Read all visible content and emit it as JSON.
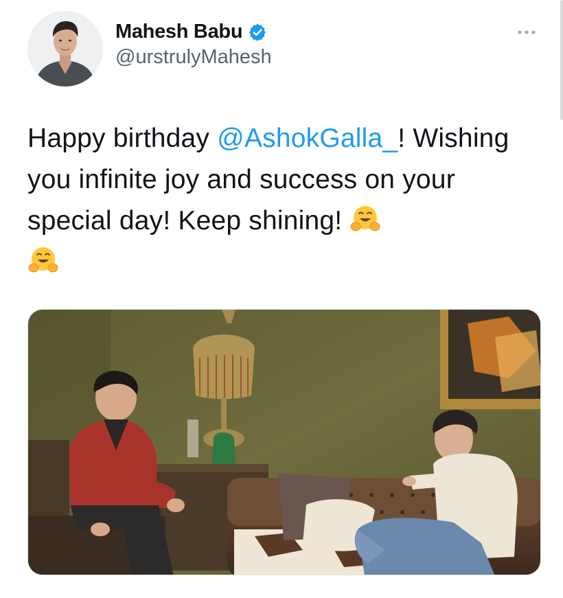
{
  "author": {
    "display_name": "Mahesh Babu",
    "handle": "@urstrulyMahesh",
    "verified": true,
    "avatar_alt": "profile photo"
  },
  "tweet": {
    "text_part1": "Happy birthday ",
    "mention": "@AshokGalla_",
    "text_part2": "! Wishing you infinite joy and success on your special day! Keep shining! ",
    "emoji_name": "hugging-face",
    "emoji_count": 2
  },
  "media": {
    "type": "photo",
    "description_icon": "photo"
  },
  "icons": {
    "verified": "verified-badge-icon",
    "more": "more-options-icon",
    "emoji": "hugging-face-emoji-icon"
  },
  "colors": {
    "mention": "#1d9bf0",
    "verified": "#1d9bf0",
    "handle": "#536471",
    "text": "#0f1419"
  }
}
